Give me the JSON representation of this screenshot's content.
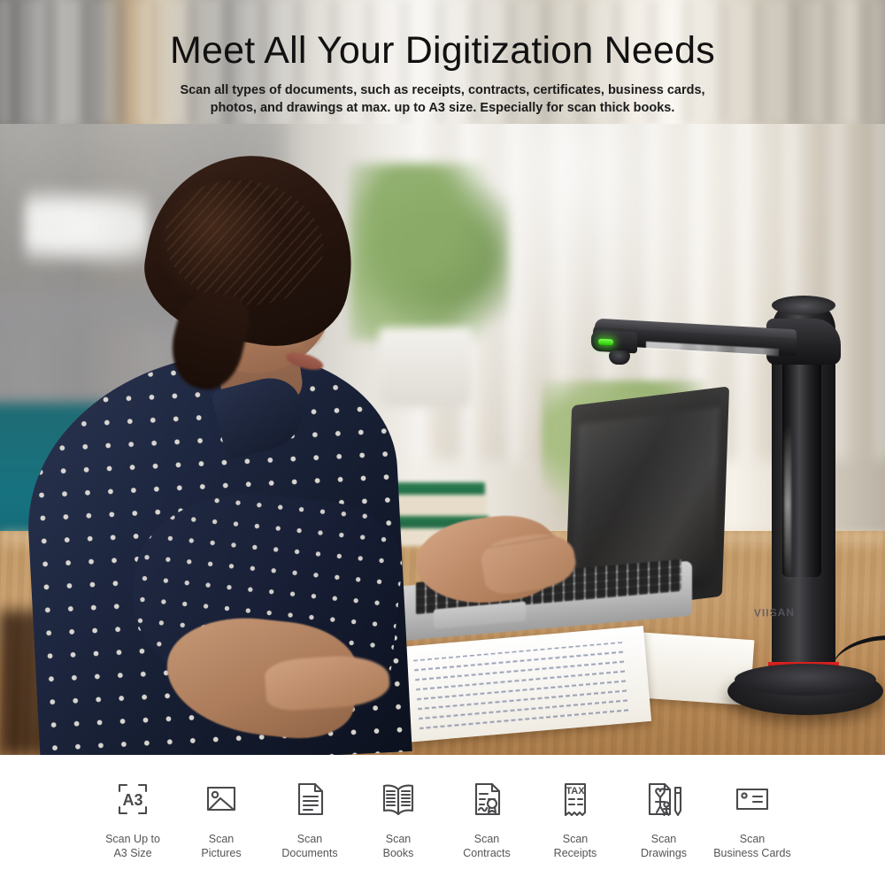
{
  "header": {
    "title": "Meet All Your Digitization Needs",
    "subtitle": "Scan all types of documents, such as receipts, contracts, certificates, business cards, photos, and drawings at max. up to A3 size. Especially for scan thick books."
  },
  "product": {
    "brand_logo": "VIISAN",
    "device": "document-scanner",
    "led_color": "#4df020",
    "accent_ring_color": "#d8201c",
    "body_color": "#1e1e21"
  },
  "scene": {
    "person": "woman-working-at-desk",
    "blouse": "navy-polka-dot",
    "chair_color": "#15707c",
    "desk_color": "#c09160",
    "laptop": "silver-open-laptop",
    "books": "stacked-green-books",
    "papers": "handwritten-notes",
    "plant": "green-potted-plant"
  },
  "features": [
    {
      "icon": "a3-frame-icon",
      "label": "Scan Up to\nA3 Size"
    },
    {
      "icon": "picture-icon",
      "label": "Scan\nPictures"
    },
    {
      "icon": "document-icon",
      "label": "Scan\nDocuments"
    },
    {
      "icon": "open-book-icon",
      "label": "Scan\nBooks"
    },
    {
      "icon": "contract-seal-icon",
      "label": "Scan\nContracts"
    },
    {
      "icon": "tax-receipt-icon",
      "label": "Scan\nReceipts"
    },
    {
      "icon": "drawing-pencil-icon",
      "label": "Scan\nDrawings"
    },
    {
      "icon": "business-card-icon",
      "label": "Scan\nBusiness Cards"
    }
  ],
  "icon_text": {
    "a3": "A3",
    "tax": "TAX"
  }
}
